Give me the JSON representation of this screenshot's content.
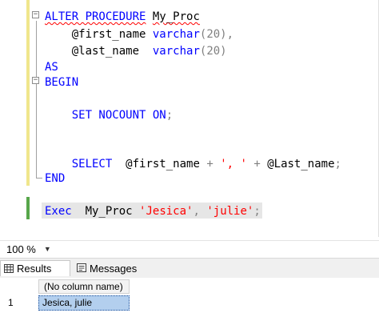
{
  "editor": {
    "lines": {
      "l1": {
        "kw1": "ALTER PROCEDURE",
        "name": "My_Proc"
      },
      "l2": {
        "param": "@first_name",
        "type": "varchar",
        "paren": "(20),"
      },
      "l3": {
        "param": "@last_name",
        "type": "varchar",
        "paren": "(20)"
      },
      "l4": {
        "kw": "AS"
      },
      "l5": {
        "kw": "BEGIN"
      },
      "l6": {
        "kw": "SET NOCOUNT ON",
        "end": ";"
      },
      "l7": {
        "kw": "SELECT",
        "p1": "@first_name",
        "plus1": "+",
        "s1": "', '",
        "plus2": "+",
        "p2": "@Last_name",
        "end": ";"
      },
      "l8": {
        "kw": "END"
      },
      "l9": {
        "kw": "Exec",
        "name": "My_Proc",
        "s1": "'Jesica'",
        "comma": ",",
        "s2": "'julie'",
        "end": ";"
      }
    },
    "fold_glyph": "−"
  },
  "zoom": {
    "value": "100 %",
    "arrow": "▼"
  },
  "tabs": {
    "results": "Results",
    "messages": "Messages"
  },
  "grid": {
    "column_header": "(No column name)",
    "rows": [
      {
        "num": "1",
        "value": "Jesica, julie"
      }
    ]
  },
  "colors": {
    "keyword": "#0000ff",
    "string": "#ff0000",
    "operator": "#808080",
    "selection": "#b3cfee"
  }
}
